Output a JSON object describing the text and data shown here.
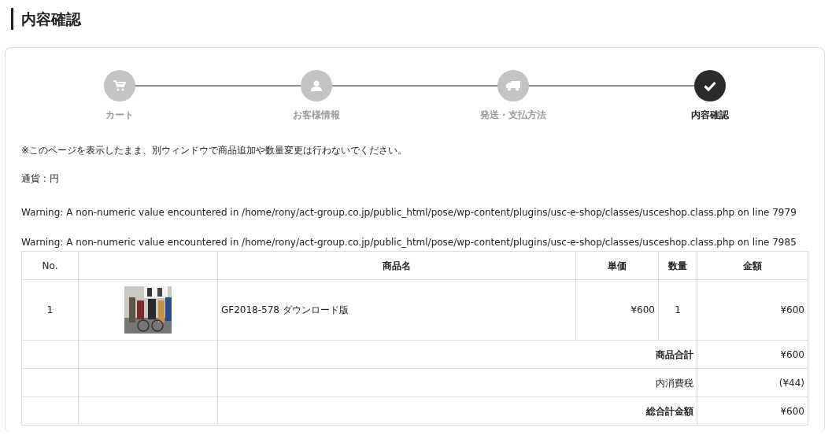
{
  "heading": "内容確認",
  "steps": [
    {
      "label": "カート",
      "selected": false
    },
    {
      "label": "お客様情報",
      "selected": false
    },
    {
      "label": "発送・支払方法",
      "selected": false
    },
    {
      "label": "内容確認",
      "selected": true
    }
  ],
  "notice": "※このページを表示したまま、別ウィンドウで商品追加や数量変更は行わないでください。",
  "currency": "通貨 : 円",
  "warnings": [
    "Warning: A non-numeric value encountered in /home/rony/act-group.co.jp/public_html/pose/wp-content/plugins/usc-e-shop/classes/usceshop.class.php on line 7979",
    "Warning: A non-numeric value encountered in /home/rony/act-group.co.jp/public_html/pose/wp-content/plugins/usc-e-shop/classes/usceshop.class.php on line 7985"
  ],
  "table": {
    "columns": [
      "No.",
      "商品名",
      "単価",
      "数量",
      "金額"
    ],
    "rows": [
      {
        "no": "1",
        "name": "GF2018-578 ダウンロード版",
        "price": "¥600",
        "quantity": "1",
        "amount": "¥600"
      }
    ],
    "summary": [
      {
        "label": "商品合計",
        "value": "¥600",
        "bold": true
      },
      {
        "label": "内消費税",
        "value": "(¥44)",
        "bold": false
      },
      {
        "label": "総合計金額",
        "value": "¥600",
        "bold": true
      }
    ]
  }
}
